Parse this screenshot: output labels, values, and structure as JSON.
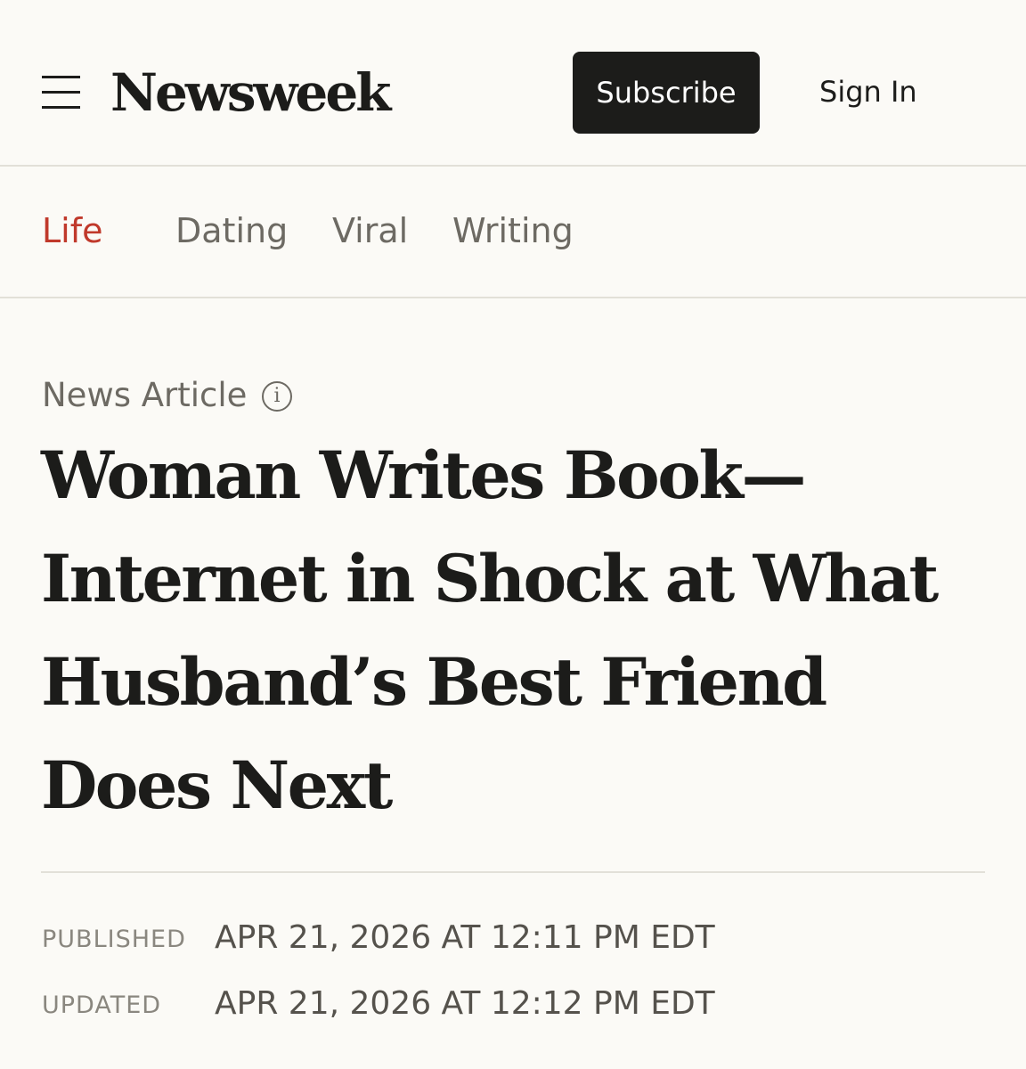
{
  "header": {
    "menu_icon": "hamburger-menu-icon",
    "logo": "Newsweek",
    "subscribe_label": "Subscribe",
    "signin_label": "Sign In"
  },
  "subnav": {
    "items": [
      {
        "label": "Life",
        "active": true
      },
      {
        "label": "Dating",
        "active": false
      },
      {
        "label": "Viral",
        "active": false
      },
      {
        "label": "Writing",
        "active": false
      }
    ],
    "active_color": "#c0392b"
  },
  "article": {
    "type_label": "News Article",
    "info_icon": "info-circle-icon",
    "headline": "Woman Writes Book—Internet in Shock at What Husband’s Best Friend Does Next",
    "published_label": "PUBLISHED",
    "published_value": "APR 21, 2026 AT 12:11 PM EDT",
    "updated_label": "UPDATED",
    "updated_value": "APR 21, 2026 AT 12:12 PM EDT"
  }
}
